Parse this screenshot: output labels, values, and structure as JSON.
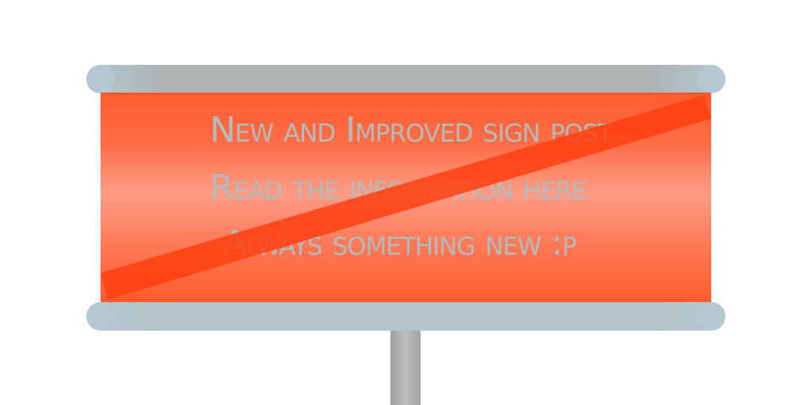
{
  "sign": {
    "lines": [
      "New and Improved sign post",
      "Read the information here",
      "Always something new :p"
    ],
    "colors": {
      "panel": "#ff5a2e",
      "strike": "#ff3f10",
      "text": "#b5b9ba",
      "rail": "#aeb3b4",
      "pole": "#a8a8a8"
    }
  }
}
